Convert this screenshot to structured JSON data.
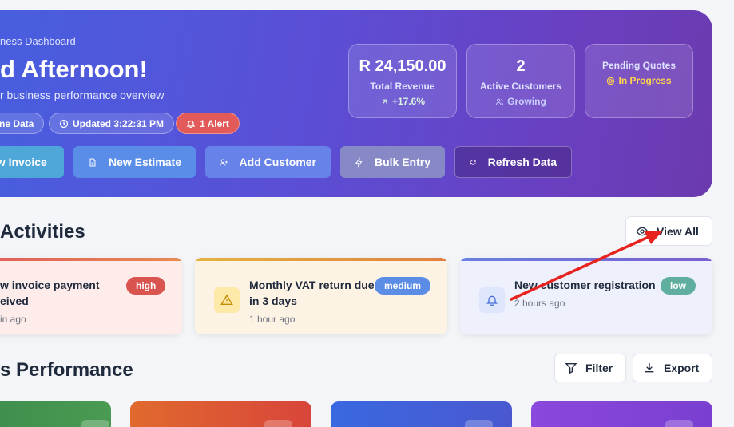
{
  "hero": {
    "subtitle": "ness Dashboard",
    "title": "d Afternoon!",
    "description": "r business performance overview",
    "pills": {
      "data": "ne Data",
      "updated": "Updated 3:22:31 PM",
      "alert": "1 Alert"
    },
    "actions": {
      "invoice": "ew Invoice",
      "estimate": "New Estimate",
      "customer": "Add Customer",
      "bulk": "Bulk Entry",
      "refresh": "Refresh Data"
    },
    "stats": {
      "revenue": {
        "value": "R 24,150.00",
        "label": "Total Revenue",
        "sub": "+17.6%"
      },
      "customers": {
        "value": "2",
        "label": "Active Customers",
        "sub": "Growing"
      },
      "quotes": {
        "label": "Pending Quotes",
        "sub": "In Progress"
      }
    }
  },
  "activities": {
    "title": "Activities",
    "view_all": "View All",
    "items": [
      {
        "title_l1": "w invoice payment",
        "title_l2": "eived",
        "time": "in ago",
        "badge": "high",
        "badge_color": "#d9534f"
      },
      {
        "title_l1": "Monthly VAT return due",
        "title_l2": "in 3 days",
        "time": "1 hour ago",
        "badge": "medium",
        "badge_color": "#5b8de6"
      },
      {
        "title_l1": "New customer registration",
        "title_l2": "",
        "time": "2 hours ago",
        "badge": "low",
        "badge_color": "#5fae9e"
      }
    ]
  },
  "performance": {
    "title": "s Performance",
    "filter": "Filter",
    "export": "Export"
  },
  "colors": {
    "annotation_arrow": "#e8231f"
  }
}
